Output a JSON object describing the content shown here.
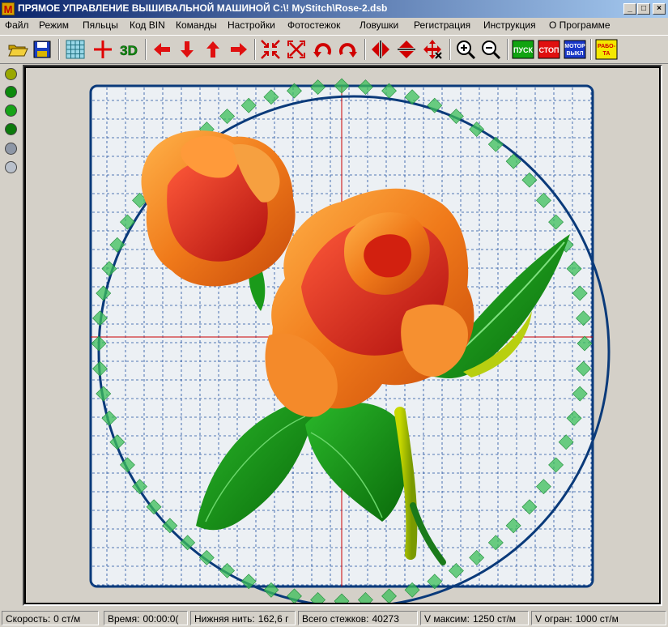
{
  "window": {
    "logo_letter": "M",
    "title": "ПРЯМОЕ УПРАВЛЕНИЕ ВЫШИВАЛЬНОЙ МАШИНОЙ  C:\\! MyStitch\\Rose-2.dsb",
    "minimize_glyph": "_",
    "maximize_glyph": "□",
    "close_glyph": "×"
  },
  "menu": [
    "Файл",
    "Режим",
    "Пяльцы",
    "Код BIN",
    "Команды",
    "Настройки",
    "Фотостежок",
    "Ловушки",
    "Регистрация",
    "Инструкция",
    "О Программе"
  ],
  "toolbar": {
    "three_d_label": "3D",
    "start_label": "ПУСК",
    "stop_label": "СТОП",
    "motor_label_1": "МОТОР",
    "motor_label_2": "ВЫКЛ",
    "work_label_1": "РАБО-",
    "work_label_2": "ТА",
    "icons": [
      "open-folder-icon",
      "save-disk-icon",
      "grid-icon",
      "crosshair-icon",
      "move-left-icon",
      "move-down-icon",
      "move-up-icon",
      "move-right-icon",
      "shrink-icon",
      "expand-icon",
      "rotate-left-icon",
      "rotate-right-icon",
      "flip-horizontal-icon",
      "flip-vertical-icon",
      "move-center-icon",
      "zoom-in-icon",
      "zoom-out-icon"
    ]
  },
  "thread_colors": [
    "#9aa800",
    "#0c8a0c",
    "#17a317",
    "#0c7a0c",
    "#8e97a6",
    "#b9c0cb"
  ],
  "design": {
    "hoop_color": "#0a3a7a",
    "grid_color": "#1f4fa0",
    "axis_color": "#cc0000",
    "canvas_bg": "#ecf0f4"
  },
  "status": {
    "speed_label": "Скорость:",
    "speed_value": "0 ст/м",
    "time_label": "Время:",
    "time_value": "00:00:0(",
    "bobbin_label": "Нижняя нить:",
    "bobbin_value": "162,6 г",
    "total_label": "Всего стежков:",
    "total_value": "40273",
    "vmax_label": "V максим:",
    "vmax_value": "1250 ст/м",
    "vlimit_label": "V огран:",
    "vlimit_value": "1000 ст/м"
  }
}
